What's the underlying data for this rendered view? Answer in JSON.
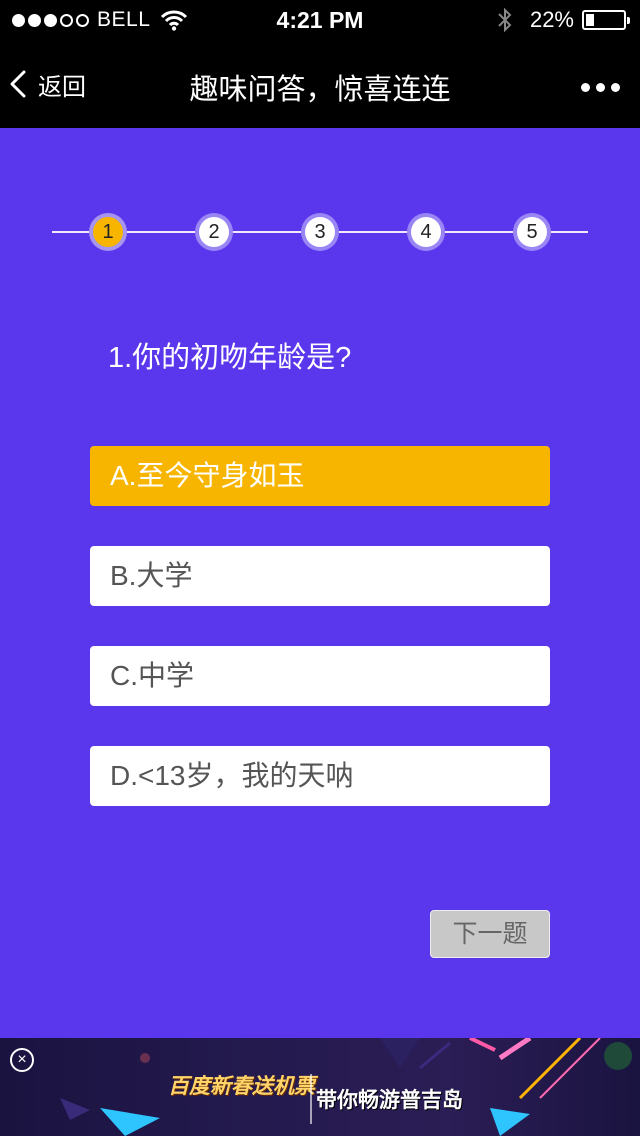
{
  "status_bar": {
    "carrier": "BELL",
    "time": "4:21 PM",
    "battery_percent": "22%",
    "battery_level": 0.22,
    "signal_full_dots": 3,
    "signal_total_dots": 5
  },
  "nav": {
    "back_label": "返回",
    "title": "趣味问答，惊喜连连"
  },
  "stepper": {
    "steps": [
      "1",
      "2",
      "3",
      "4",
      "5"
    ],
    "active_index": 0
  },
  "question": {
    "text": "1.你的初吻年龄是?"
  },
  "options": [
    {
      "label": "A.至今守身如玉",
      "selected": true
    },
    {
      "label": "B.大学",
      "selected": false
    },
    {
      "label": "C.中学",
      "selected": false
    },
    {
      "label": "D.<13岁，我的天呐",
      "selected": false
    }
  ],
  "next_button": {
    "label": "下一题"
  },
  "ad": {
    "close_icon": "close-icon",
    "line1": "百度新春送机票",
    "line2": "带你畅游普吉岛"
  },
  "colors": {
    "background": "#5a37ec",
    "accent": "#f7b500",
    "bar": "#000000"
  }
}
